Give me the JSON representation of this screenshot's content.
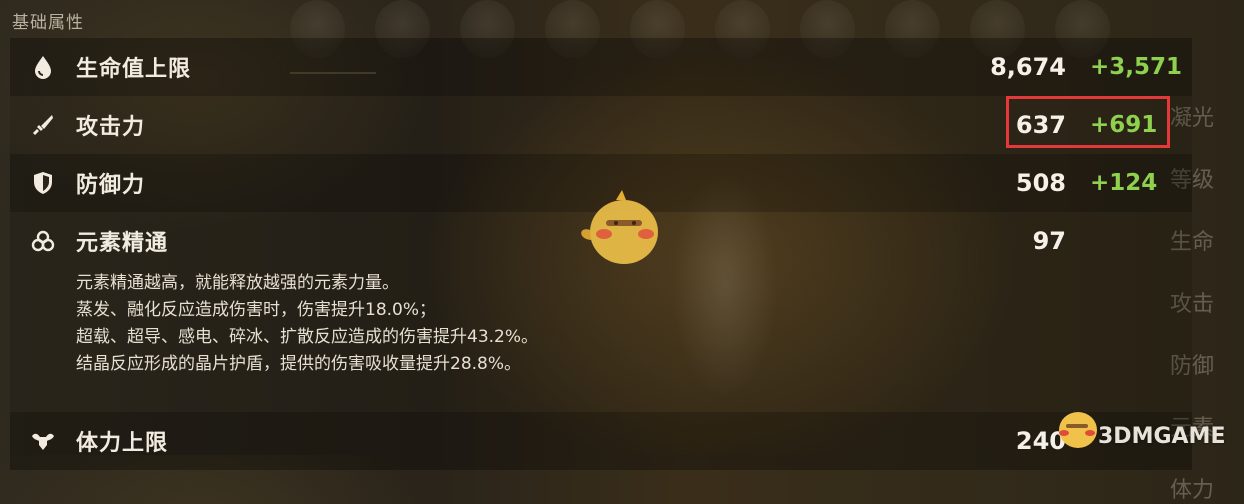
{
  "section_title": "基础属性",
  "stats": [
    {
      "icon": "water-drop-icon",
      "label": "生命值上限",
      "base": "8,674",
      "bonus": "+3,571"
    },
    {
      "icon": "sword-icon",
      "label": "攻击力",
      "base": "637",
      "bonus": "+691"
    },
    {
      "icon": "shield-icon",
      "label": "防御力",
      "base": "508",
      "bonus": "+124"
    },
    {
      "icon": "elemental-mastery-icon",
      "label": "元素精通",
      "base": "97",
      "bonus": ""
    },
    {
      "icon": "stamina-icon",
      "label": "体力上限",
      "base": "240",
      "bonus": ""
    }
  ],
  "elemental_mastery_description": [
    "元素精通越高，就能释放越强的元素力量。",
    "蒸发、融化反应造成伤害时，伤害提升18.0%；",
    "超载、超导、感电、碎冰、扩散反应造成的伤害提升43.2%。",
    "结晶反应形成的晶片护盾，提供的伤害吸收量提升28.8%。"
  ],
  "background_side_text": [
    "凝光",
    "等级",
    "生命",
    "攻击",
    "防御",
    "元素",
    "体力"
  ],
  "watermark": "3DMGAME",
  "colors": {
    "bonus_green": "#8fd14f",
    "highlight_red": "#e3393a",
    "text_light": "#f2ece0"
  }
}
